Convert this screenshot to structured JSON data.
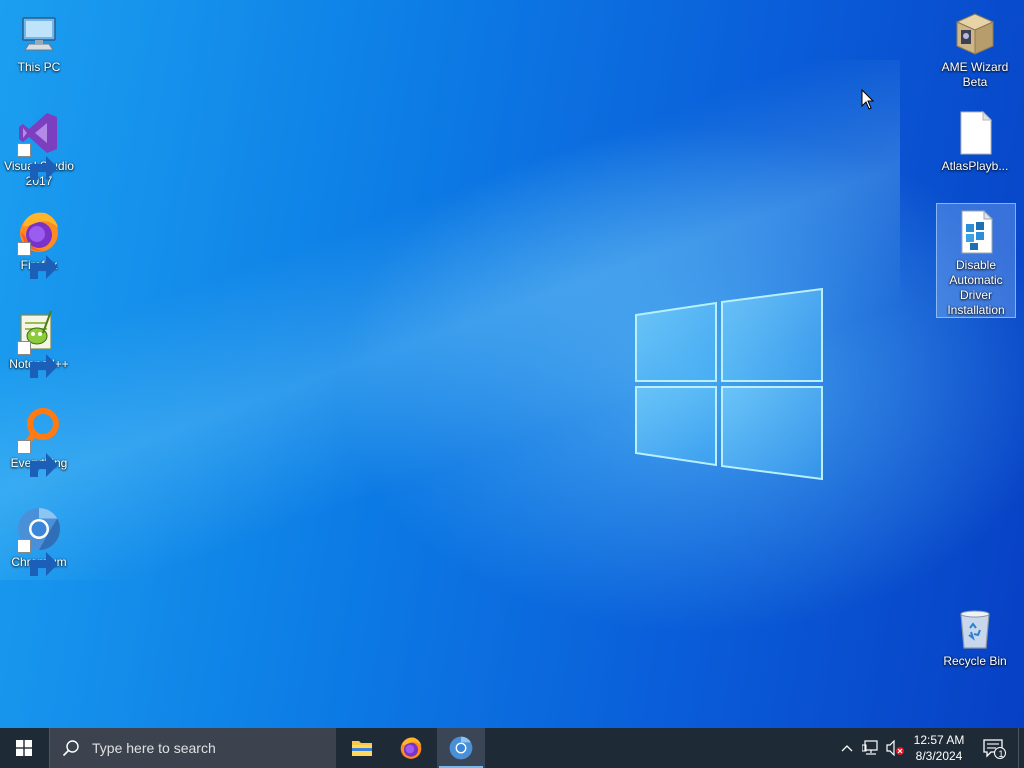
{
  "desktop": {
    "left_icons": [
      {
        "label": "This PC",
        "icon": "this-pc-icon"
      },
      {
        "label": "Visual Studio 2017",
        "icon": "visual-studio-icon"
      },
      {
        "label": "Firefox",
        "icon": "firefox-icon"
      },
      {
        "label": "Notepad++",
        "icon": "notepad-plus-plus-icon"
      },
      {
        "label": "Everything",
        "icon": "everything-icon"
      },
      {
        "label": "Chromium",
        "icon": "chromium-icon"
      }
    ],
    "right_icons": [
      {
        "label": "AME Wizard Beta",
        "icon": "ame-wizard-icon"
      },
      {
        "label": "AtlasPlayb...",
        "icon": "file-icon"
      },
      {
        "label": "Disable Automatic Driver Installation",
        "icon": "registry-file-icon",
        "selected": true
      },
      {
        "label": "Recycle Bin",
        "icon": "recycle-bin-icon"
      }
    ]
  },
  "taskbar": {
    "search_placeholder": "Type here to search",
    "pinned": [
      {
        "name": "File Explorer",
        "icon": "file-explorer-icon"
      },
      {
        "name": "Firefox",
        "icon": "firefox-icon"
      },
      {
        "name": "Chromium",
        "icon": "chromium-icon",
        "active": true
      }
    ],
    "clock": {
      "time": "12:57 AM",
      "date": "8/3/2024"
    },
    "notification_count": "1"
  },
  "colors": {
    "taskbar": "#1f2a37",
    "accent": "#76b9ed"
  }
}
